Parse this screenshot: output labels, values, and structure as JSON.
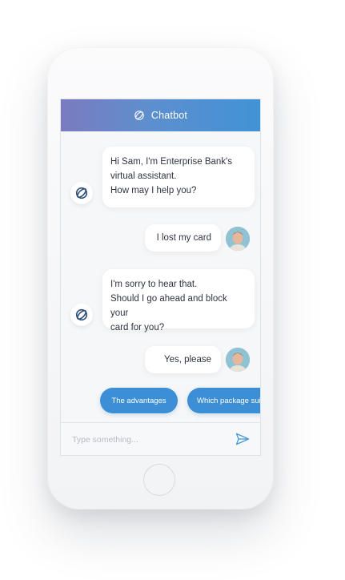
{
  "header": {
    "title": "Chatbot",
    "icon": "chatbot-logo-icon"
  },
  "messages": [
    {
      "from": "bot",
      "lines": [
        "Hi Sam, I'm Enterprise Bank's",
        "virtual assistant.",
        "How may I help you?"
      ]
    },
    {
      "from": "user",
      "text": "I lost my card"
    },
    {
      "from": "bot",
      "lines": [
        "I'm sorry to hear that.",
        "Should I go ahead and block your",
        "card for you?"
      ]
    },
    {
      "from": "user",
      "text": "Yes, please"
    }
  ],
  "quick_replies": [
    "The advantages",
    "Which package suits"
  ],
  "composer": {
    "placeholder": "Type something...",
    "send_icon": "send-icon"
  },
  "colors": {
    "accent": "#3c8fd4",
    "header_start": "#7b7bbf",
    "header_end": "#4192d6"
  }
}
